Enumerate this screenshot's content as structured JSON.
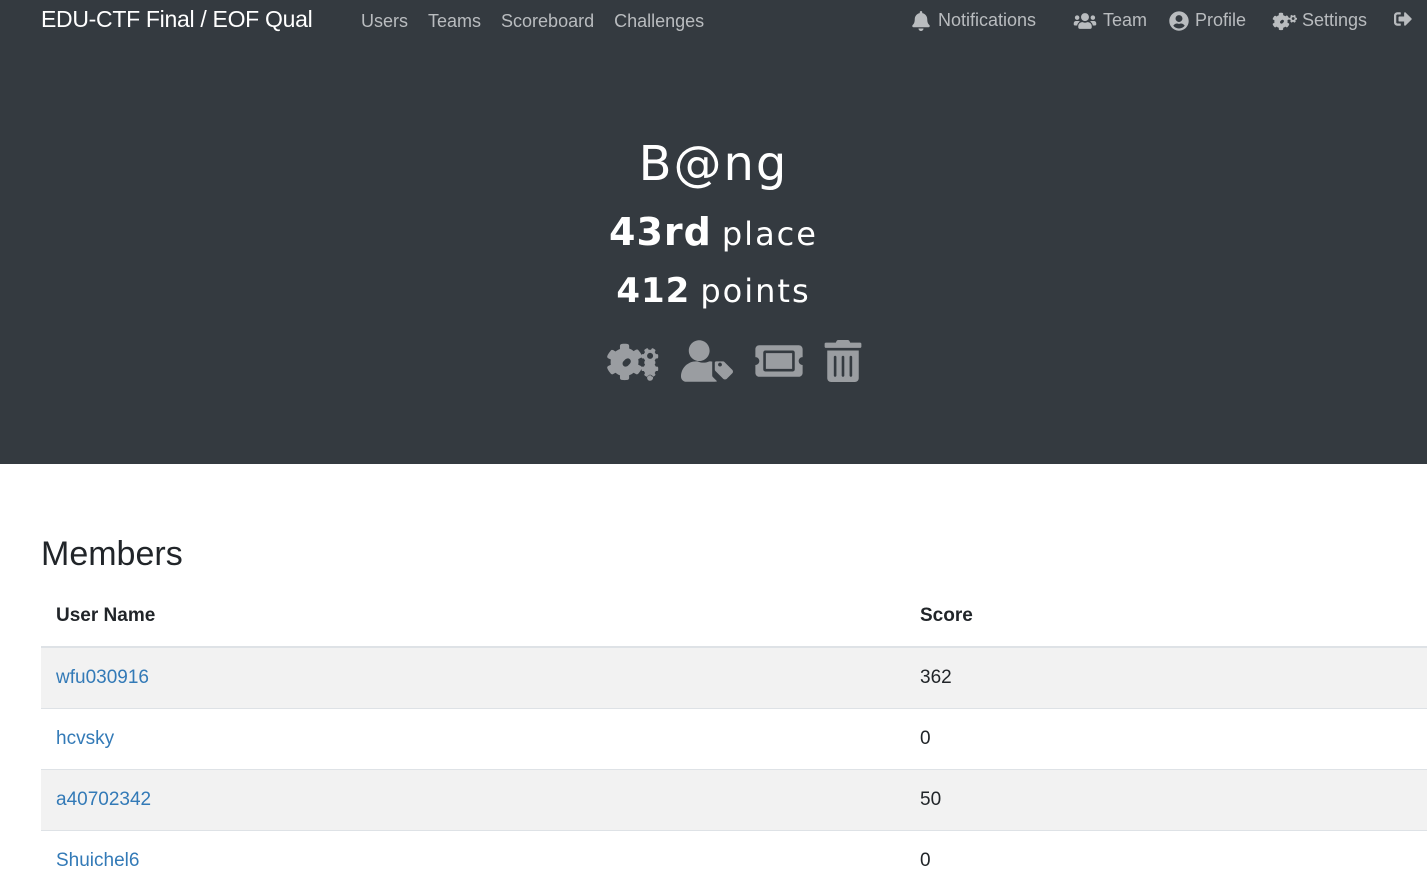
{
  "navbar": {
    "brand": "EDU-CTF Final / EOF Qual",
    "left_links": [
      "Users",
      "Teams",
      "Scoreboard",
      "Challenges"
    ],
    "right_links": {
      "notifications": "Notifications",
      "team": "Team",
      "profile": "Profile",
      "settings": "Settings"
    },
    "icons": [
      "bell-icon",
      "users-icon",
      "user-circle-icon",
      "cogs-icon",
      "sign-out-icon"
    ]
  },
  "team": {
    "name": "B@ng",
    "place_number": "43rd",
    "place_label": "place",
    "points_number": "412",
    "points_label": "points"
  },
  "admin_actions": [
    "settings-cogs-icon",
    "user-tag-icon",
    "ticket-icon",
    "trash-icon"
  ],
  "members": {
    "title": "Members",
    "columns": [
      "User Name",
      "Score"
    ],
    "rows": [
      {
        "user": "wfu030916",
        "score": "362"
      },
      {
        "user": "hcvsky",
        "score": "0"
      },
      {
        "user": "a40702342",
        "score": "50"
      },
      {
        "user": "Shuichel6",
        "score": "0"
      }
    ]
  },
  "colors": {
    "navbar_bg": "#343a40",
    "hero_bg": "#343a40",
    "link": "#337ab7",
    "stripe": "#f2f2f2"
  }
}
